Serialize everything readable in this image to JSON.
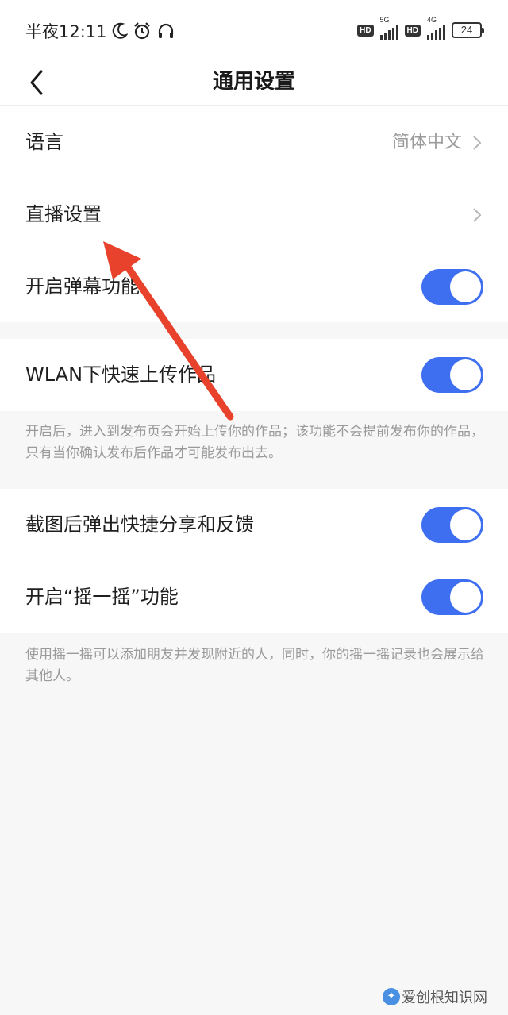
{
  "status_bar": {
    "time": "半夜12:11",
    "network_1": "5G",
    "network_2": "4G",
    "hd_1": "HD",
    "hd_2": "HD",
    "battery": "24",
    "icons": [
      "moon-icon",
      "alarm-icon",
      "headphones-icon"
    ]
  },
  "nav": {
    "title": "通用设置",
    "back_icon": "back-chevron-icon"
  },
  "settings": {
    "language_label": "语言",
    "language_value": "简体中文",
    "live_label": "直播设置",
    "danmaku_label": "开启弹幕功能",
    "danmaku_on": true,
    "wlan_label": "WLAN下快速上传作品",
    "wlan_on": true,
    "wlan_note": "开启后，进入到发布页会开始上传你的作品；该功能不会提前发布你的作品，只有当你确认发布后作品才可能发布出去。",
    "screenshot_label": "截图后弹出快捷分享和反馈",
    "screenshot_on": true,
    "shake_label": "开启“摇一摇”功能",
    "shake_on": true,
    "shake_note": "使用摇一摇可以添加朋友并发现附近的人，同时，你的摇一摇记录也会展示给其他人。"
  },
  "colors": {
    "toggle_on": "#3e6ff0",
    "annotation_arrow": "#e8412c"
  },
  "watermark": {
    "text": "爱创根知识网"
  }
}
